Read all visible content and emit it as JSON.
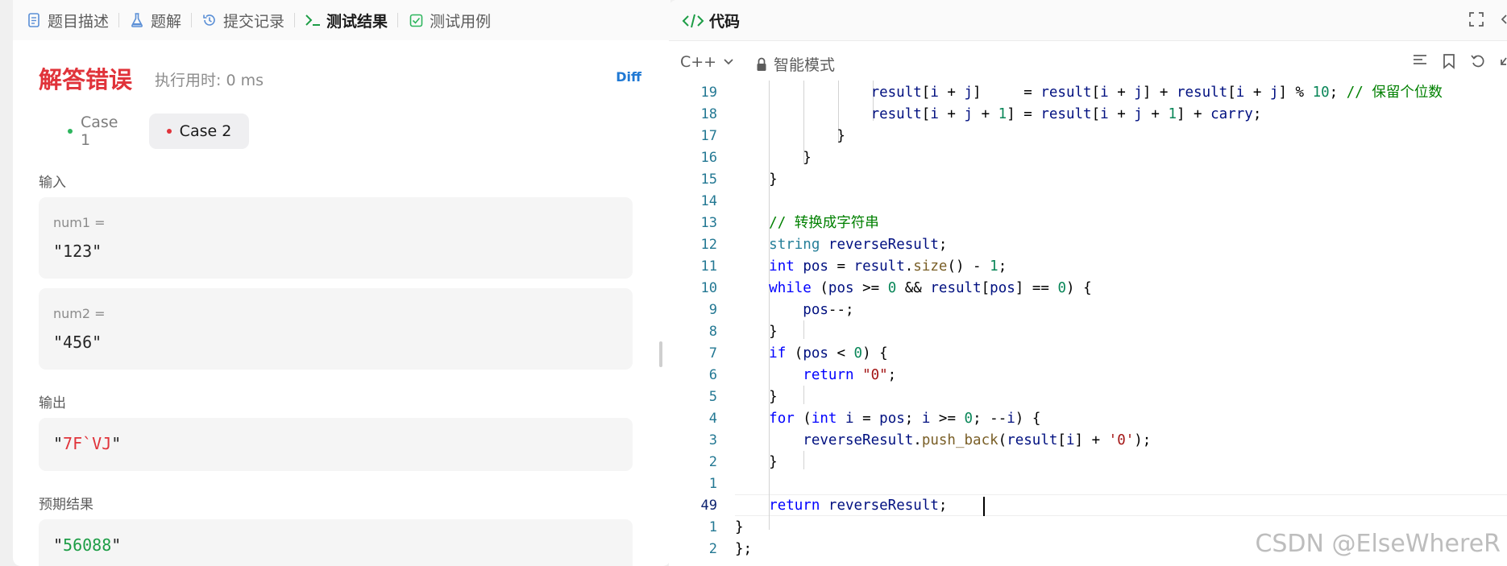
{
  "left_tabs": [
    {
      "label": "题目描述",
      "icon": "document-icon"
    },
    {
      "label": "题解",
      "icon": "flask-icon"
    },
    {
      "label": "提交记录",
      "icon": "history-icon"
    },
    {
      "label": "测试结果",
      "icon": "terminal-icon",
      "active": true
    },
    {
      "label": "测试用例",
      "icon": "checkbox-icon"
    }
  ],
  "result": {
    "status": "解答错误",
    "runtime": "执行用时: 0 ms",
    "diff_label": "Diff"
  },
  "cases": [
    {
      "label": "Case 1",
      "dot_color": "#2db55d"
    },
    {
      "label": "Case 2",
      "dot_color": "#e0333a",
      "selected": true
    }
  ],
  "input_section": {
    "label": "输入",
    "params": [
      {
        "name": "num1 =",
        "value": "123"
      },
      {
        "name": "num2 =",
        "value": "456"
      }
    ]
  },
  "output_section": {
    "label": "输出",
    "value": "7F`VJ"
  },
  "expected_section": {
    "label": "预期结果",
    "value": "56088"
  },
  "code_panel": {
    "title": "代码",
    "language": "C++",
    "mode": "智能模式",
    "line_numbers": [
      "19",
      "18",
      "17",
      "16",
      "15",
      "14",
      "13",
      "12",
      "11",
      "10",
      "9",
      "8",
      "7",
      "6",
      "5",
      "4",
      "3",
      "2",
      "1",
      "49",
      "1",
      "2"
    ],
    "current_line_number": "49",
    "lines": [
      "                result[i + j]     = result[i + j] + result[i + j] % 10; // 保留个位数",
      "                result[i + j + 1] = result[i + j + 1] + carry;",
      "            }",
      "        }",
      "    }",
      "",
      "    // 转换成字符串",
      "    string reverseResult;",
      "    int pos = result.size() - 1;",
      "    while (pos >= 0 && result[pos] == 0) {",
      "        pos--;",
      "    }",
      "    if (pos < 0) {",
      "        return \"0\";",
      "    }",
      "    for (int i = pos; i >= 0; --i) {",
      "        reverseResult.push_back(result[i] + '0');",
      "    }",
      "",
      "    return reverseResult;",
      "}",
      "};"
    ]
  },
  "watermark": "CSDN @ElseWhereR",
  "colors": {
    "error_red": "#e0333a",
    "accent_blue": "#2079d4",
    "success_green": "#2db55d",
    "keyword_blue": "#0000ff",
    "comment_green": "#008000",
    "number_green": "#098658",
    "string_red": "#a31515"
  }
}
